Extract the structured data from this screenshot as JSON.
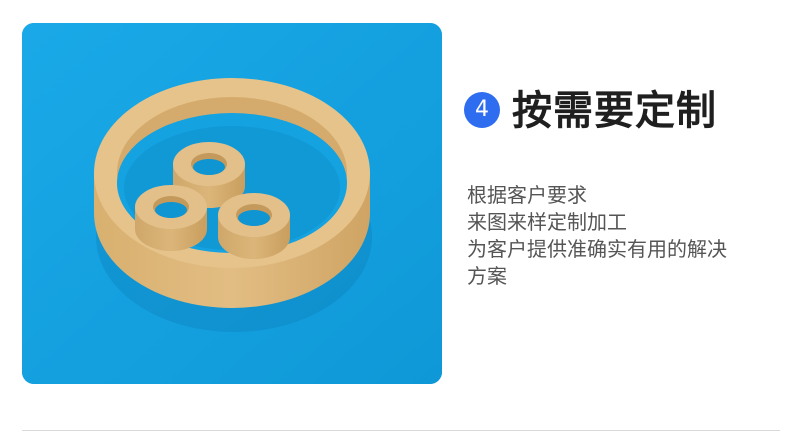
{
  "feature": {
    "step_number": "4",
    "title": "按需要定制",
    "description_lines": [
      "根据客户要求",
      "来图来样定制加工",
      "为客户提供准确实有用的解决",
      "方案"
    ]
  },
  "photo": {
    "subject": "ceramic-rings",
    "background_color": "#14a2e1",
    "ring_color": "#ddb67a"
  },
  "colors": {
    "badge": "#2f6df0",
    "title": "#1f1f1f",
    "body_text": "#555555",
    "divider": "#d9d9d9"
  }
}
